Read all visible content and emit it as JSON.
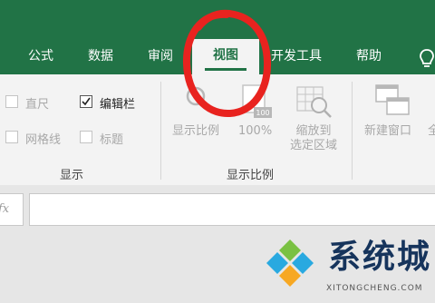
{
  "tabs": [
    {
      "label": "公式"
    },
    {
      "label": "数据"
    },
    {
      "label": "审阅"
    },
    {
      "label": "视图",
      "active": true
    },
    {
      "label": "开发工具"
    },
    {
      "label": "帮助"
    }
  ],
  "show_group": {
    "label": "显示",
    "checkboxes": [
      {
        "label": "直尺",
        "checked": false,
        "enabled": false
      },
      {
        "label": "编辑栏",
        "checked": true,
        "enabled": true
      },
      {
        "label": "网格线",
        "checked": false,
        "enabled": false
      },
      {
        "label": "标题",
        "checked": false,
        "enabled": false
      }
    ]
  },
  "zoom_group": {
    "label": "显示比例",
    "zoom_button": "显示比例",
    "hundred_button": "100%",
    "hundred_icon_text": "100",
    "zoom_selection_line1": "缩放到",
    "zoom_selection_line2": "选定区域"
  },
  "window_group": {
    "new_window": "新建窗口",
    "truncated": "全"
  },
  "formula_bar": {
    "fx_label": "fx",
    "value": ""
  },
  "watermark": {
    "brand": "系统城",
    "url": "XITONGCHENG.COM"
  },
  "colors": {
    "tab_bar": "#217346",
    "ribbon": "#f3f3f3",
    "annotation": "#e8231f",
    "disabled_text": "#a8a8a8"
  }
}
